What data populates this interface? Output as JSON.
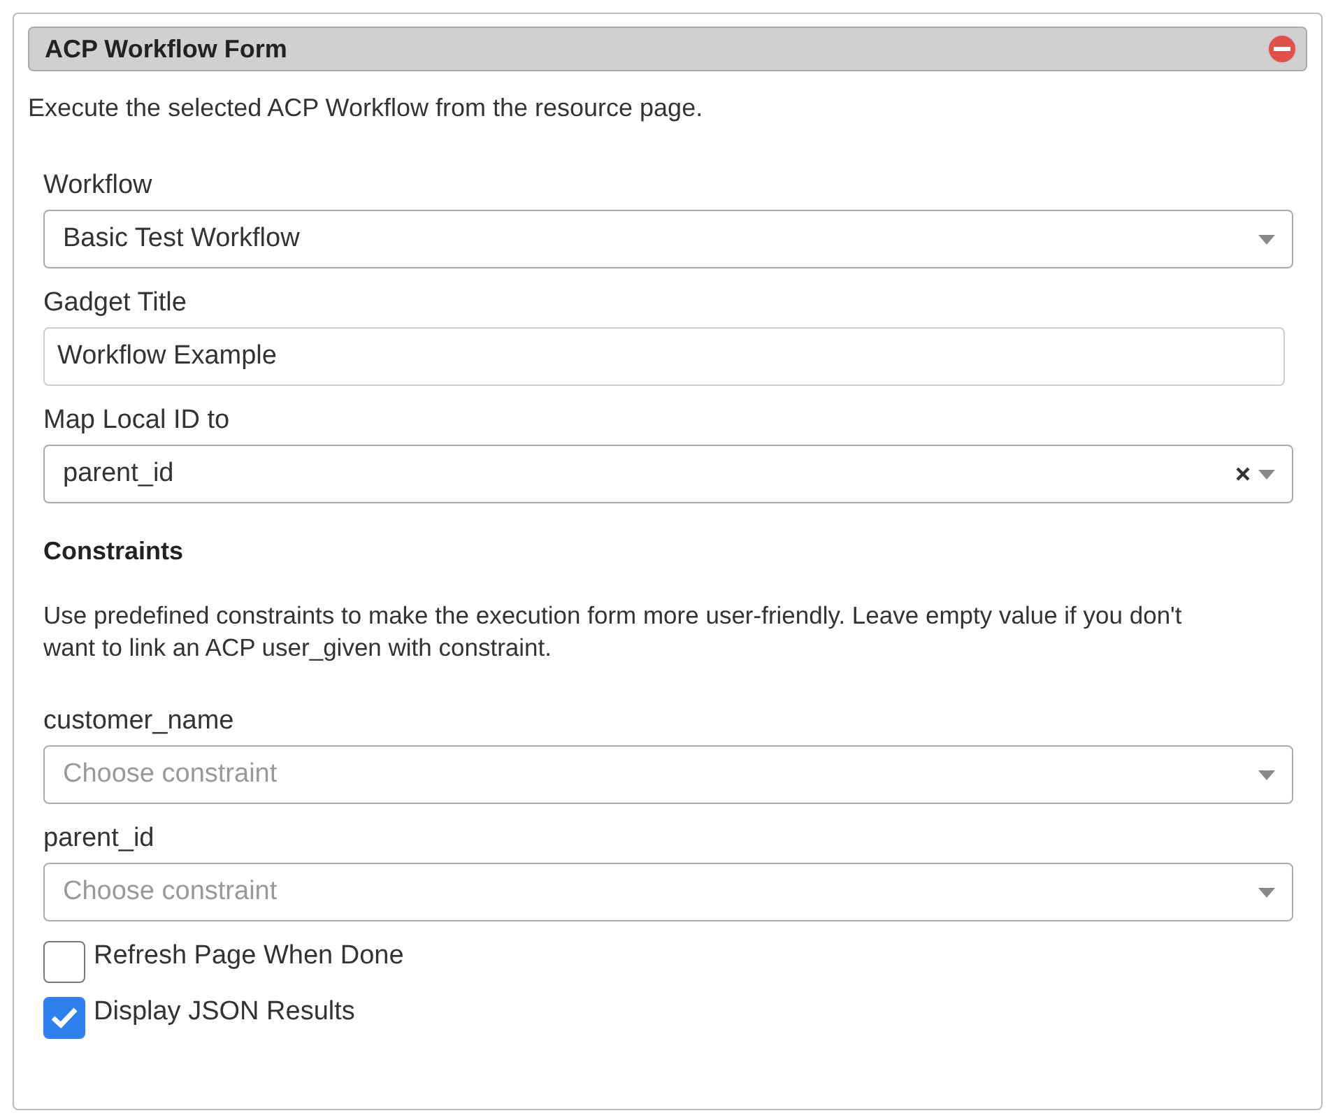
{
  "panel": {
    "title": "ACP Workflow Form",
    "description": "Execute the selected ACP Workflow from the resource page."
  },
  "fields": [
    {
      "kind": "select",
      "label": "Workflow",
      "value": "Basic Test Workflow",
      "clearable": false
    },
    {
      "kind": "text",
      "label": "Gadget Title",
      "value": "Workflow Example"
    },
    {
      "kind": "select",
      "label": "Map Local ID to",
      "value": "parent_id",
      "clearable": true
    }
  ],
  "constraints": {
    "heading": "Constraints",
    "description": "Use predefined constraints to make the execution form more user-friendly. Leave empty value if you don't want to link an ACP user_given with constraint.",
    "fields": [
      {
        "kind": "select",
        "label": "customer_name",
        "placeholder": "Choose constraint",
        "clearable": false
      },
      {
        "kind": "select",
        "label": "parent_id",
        "placeholder": "Choose constraint",
        "clearable": false
      }
    ]
  },
  "options": [
    {
      "label": "Refresh Page When Done",
      "checked": false
    },
    {
      "label": "Display JSON Results",
      "checked": true
    }
  ]
}
